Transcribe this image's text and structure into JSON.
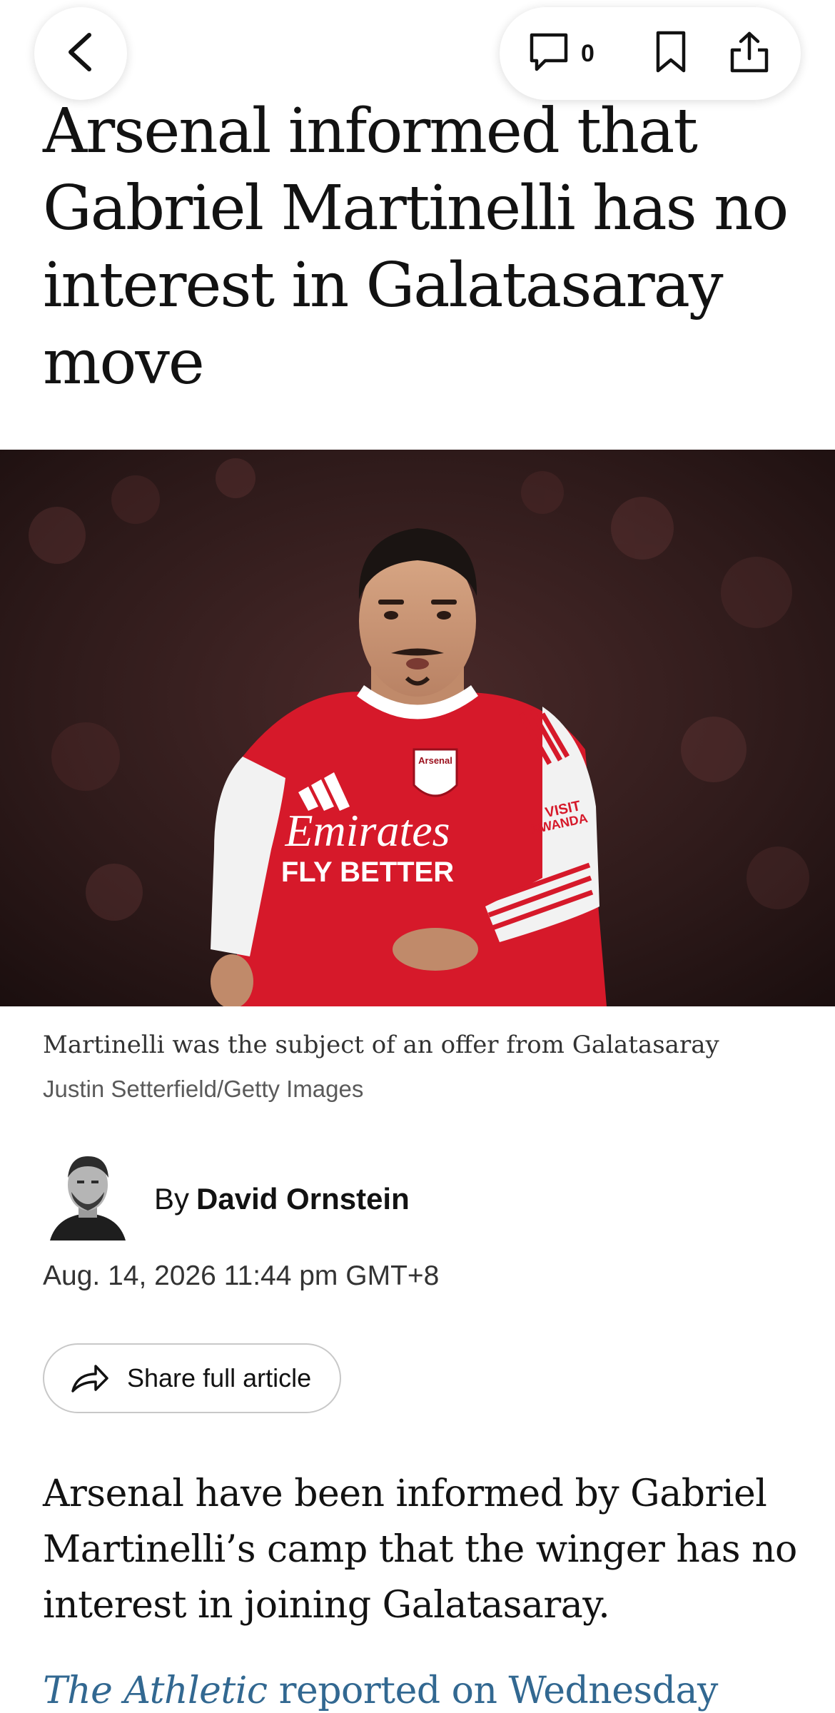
{
  "toolbar": {
    "comment_count": "0"
  },
  "article": {
    "headline": "Arsenal informed that Gabriel Martinelli has no interest in Galatasaray move",
    "image_caption": "Martinelli was the subject of an offer from Galatasaray",
    "image_credit": "Justin Setterfield/Getty Images",
    "image_text": {
      "club_badge": "Arsenal",
      "sponsor_line1": "Emirates",
      "sponsor_line2": "FLY BETTER",
      "sleeve_line1": "VISIT",
      "sleeve_line2": "RWANDA"
    },
    "byline_prefix": "By",
    "author": "David Ornstein",
    "timestamp": "Aug. 14, 2026 11:44 pm GMT+8",
    "share_label": "Share full article",
    "paragraph_1": "Arsenal have been informed by Gabriel Martinelli’s camp that the winger has no interest in joining Galatasaray.",
    "paragraph_2_publication": "The Athletic",
    "paragraph_2_rest": " reported on Wednesday"
  },
  "icons": {
    "back": "chevron-left-icon",
    "comments": "comment-icon",
    "bookmark": "bookmark-icon",
    "share": "share-icon",
    "share_article": "share-arrow-icon"
  },
  "colors": {
    "text": "#121212",
    "link": "#326891",
    "shirt_red": "#d6192a"
  }
}
